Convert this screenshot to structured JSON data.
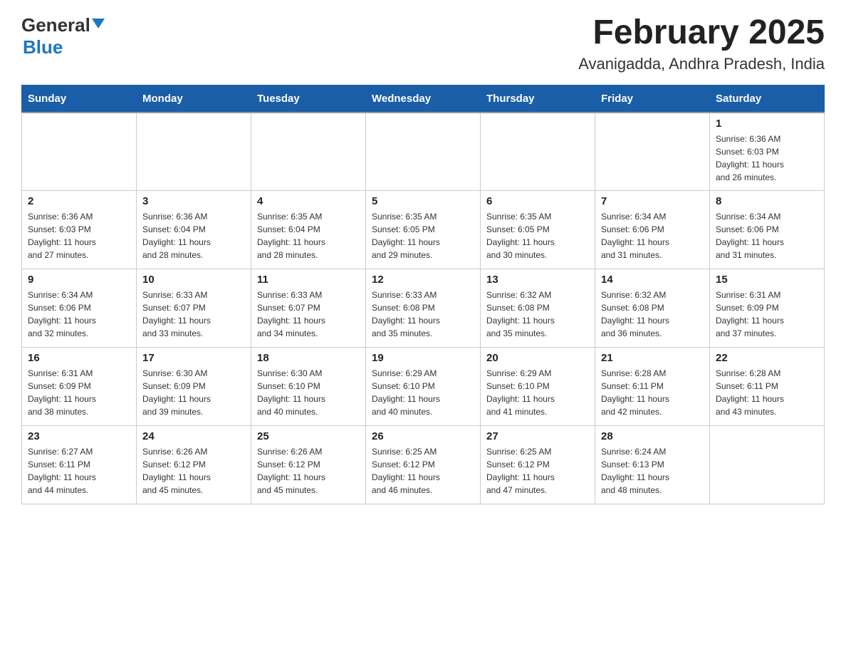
{
  "logo": {
    "general": "General",
    "blue": "Blue"
  },
  "header": {
    "month_title": "February 2025",
    "location": "Avanigadda, Andhra Pradesh, India"
  },
  "weekdays": [
    "Sunday",
    "Monday",
    "Tuesday",
    "Wednesday",
    "Thursday",
    "Friday",
    "Saturday"
  ],
  "weeks": [
    [
      {
        "day": "",
        "info": ""
      },
      {
        "day": "",
        "info": ""
      },
      {
        "day": "",
        "info": ""
      },
      {
        "day": "",
        "info": ""
      },
      {
        "day": "",
        "info": ""
      },
      {
        "day": "",
        "info": ""
      },
      {
        "day": "1",
        "info": "Sunrise: 6:36 AM\nSunset: 6:03 PM\nDaylight: 11 hours\nand 26 minutes."
      }
    ],
    [
      {
        "day": "2",
        "info": "Sunrise: 6:36 AM\nSunset: 6:03 PM\nDaylight: 11 hours\nand 27 minutes."
      },
      {
        "day": "3",
        "info": "Sunrise: 6:36 AM\nSunset: 6:04 PM\nDaylight: 11 hours\nand 28 minutes."
      },
      {
        "day": "4",
        "info": "Sunrise: 6:35 AM\nSunset: 6:04 PM\nDaylight: 11 hours\nand 28 minutes."
      },
      {
        "day": "5",
        "info": "Sunrise: 6:35 AM\nSunset: 6:05 PM\nDaylight: 11 hours\nand 29 minutes."
      },
      {
        "day": "6",
        "info": "Sunrise: 6:35 AM\nSunset: 6:05 PM\nDaylight: 11 hours\nand 30 minutes."
      },
      {
        "day": "7",
        "info": "Sunrise: 6:34 AM\nSunset: 6:06 PM\nDaylight: 11 hours\nand 31 minutes."
      },
      {
        "day": "8",
        "info": "Sunrise: 6:34 AM\nSunset: 6:06 PM\nDaylight: 11 hours\nand 31 minutes."
      }
    ],
    [
      {
        "day": "9",
        "info": "Sunrise: 6:34 AM\nSunset: 6:06 PM\nDaylight: 11 hours\nand 32 minutes."
      },
      {
        "day": "10",
        "info": "Sunrise: 6:33 AM\nSunset: 6:07 PM\nDaylight: 11 hours\nand 33 minutes."
      },
      {
        "day": "11",
        "info": "Sunrise: 6:33 AM\nSunset: 6:07 PM\nDaylight: 11 hours\nand 34 minutes."
      },
      {
        "day": "12",
        "info": "Sunrise: 6:33 AM\nSunset: 6:08 PM\nDaylight: 11 hours\nand 35 minutes."
      },
      {
        "day": "13",
        "info": "Sunrise: 6:32 AM\nSunset: 6:08 PM\nDaylight: 11 hours\nand 35 minutes."
      },
      {
        "day": "14",
        "info": "Sunrise: 6:32 AM\nSunset: 6:08 PM\nDaylight: 11 hours\nand 36 minutes."
      },
      {
        "day": "15",
        "info": "Sunrise: 6:31 AM\nSunset: 6:09 PM\nDaylight: 11 hours\nand 37 minutes."
      }
    ],
    [
      {
        "day": "16",
        "info": "Sunrise: 6:31 AM\nSunset: 6:09 PM\nDaylight: 11 hours\nand 38 minutes."
      },
      {
        "day": "17",
        "info": "Sunrise: 6:30 AM\nSunset: 6:09 PM\nDaylight: 11 hours\nand 39 minutes."
      },
      {
        "day": "18",
        "info": "Sunrise: 6:30 AM\nSunset: 6:10 PM\nDaylight: 11 hours\nand 40 minutes."
      },
      {
        "day": "19",
        "info": "Sunrise: 6:29 AM\nSunset: 6:10 PM\nDaylight: 11 hours\nand 40 minutes."
      },
      {
        "day": "20",
        "info": "Sunrise: 6:29 AM\nSunset: 6:10 PM\nDaylight: 11 hours\nand 41 minutes."
      },
      {
        "day": "21",
        "info": "Sunrise: 6:28 AM\nSunset: 6:11 PM\nDaylight: 11 hours\nand 42 minutes."
      },
      {
        "day": "22",
        "info": "Sunrise: 6:28 AM\nSunset: 6:11 PM\nDaylight: 11 hours\nand 43 minutes."
      }
    ],
    [
      {
        "day": "23",
        "info": "Sunrise: 6:27 AM\nSunset: 6:11 PM\nDaylight: 11 hours\nand 44 minutes."
      },
      {
        "day": "24",
        "info": "Sunrise: 6:26 AM\nSunset: 6:12 PM\nDaylight: 11 hours\nand 45 minutes."
      },
      {
        "day": "25",
        "info": "Sunrise: 6:26 AM\nSunset: 6:12 PM\nDaylight: 11 hours\nand 45 minutes."
      },
      {
        "day": "26",
        "info": "Sunrise: 6:25 AM\nSunset: 6:12 PM\nDaylight: 11 hours\nand 46 minutes."
      },
      {
        "day": "27",
        "info": "Sunrise: 6:25 AM\nSunset: 6:12 PM\nDaylight: 11 hours\nand 47 minutes."
      },
      {
        "day": "28",
        "info": "Sunrise: 6:24 AM\nSunset: 6:13 PM\nDaylight: 11 hours\nand 48 minutes."
      },
      {
        "day": "",
        "info": ""
      }
    ]
  ]
}
